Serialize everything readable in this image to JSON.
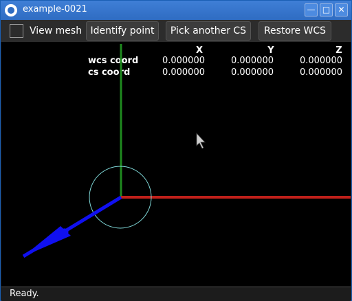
{
  "window": {
    "title": "example-0021",
    "minimize_glyph": "—",
    "maximize_glyph": "□",
    "close_glyph": "✕"
  },
  "toolbar": {
    "view_mesh_label": "View mesh",
    "view_mesh_checked": false,
    "identify_point_label": "Identify point",
    "pick_cs_label": "Pick another CS",
    "restore_wcs_label": "Restore WCS"
  },
  "coords": {
    "headers": [
      "X",
      "Y",
      "Z"
    ],
    "rows": [
      {
        "label": "wcs coord",
        "values": [
          "0.000000",
          "0.000000",
          "0.000000"
        ]
      },
      {
        "label": "cs coord",
        "values": [
          "0.000000",
          "0.000000",
          "0.000000"
        ]
      }
    ]
  },
  "scene": {
    "x_axis_color": "#c0201a",
    "y_axis_color": "#1e8a1e",
    "z_axis_color": "#1010f0",
    "circle_color": "#7fd8d8"
  },
  "status": {
    "text": "Ready."
  }
}
